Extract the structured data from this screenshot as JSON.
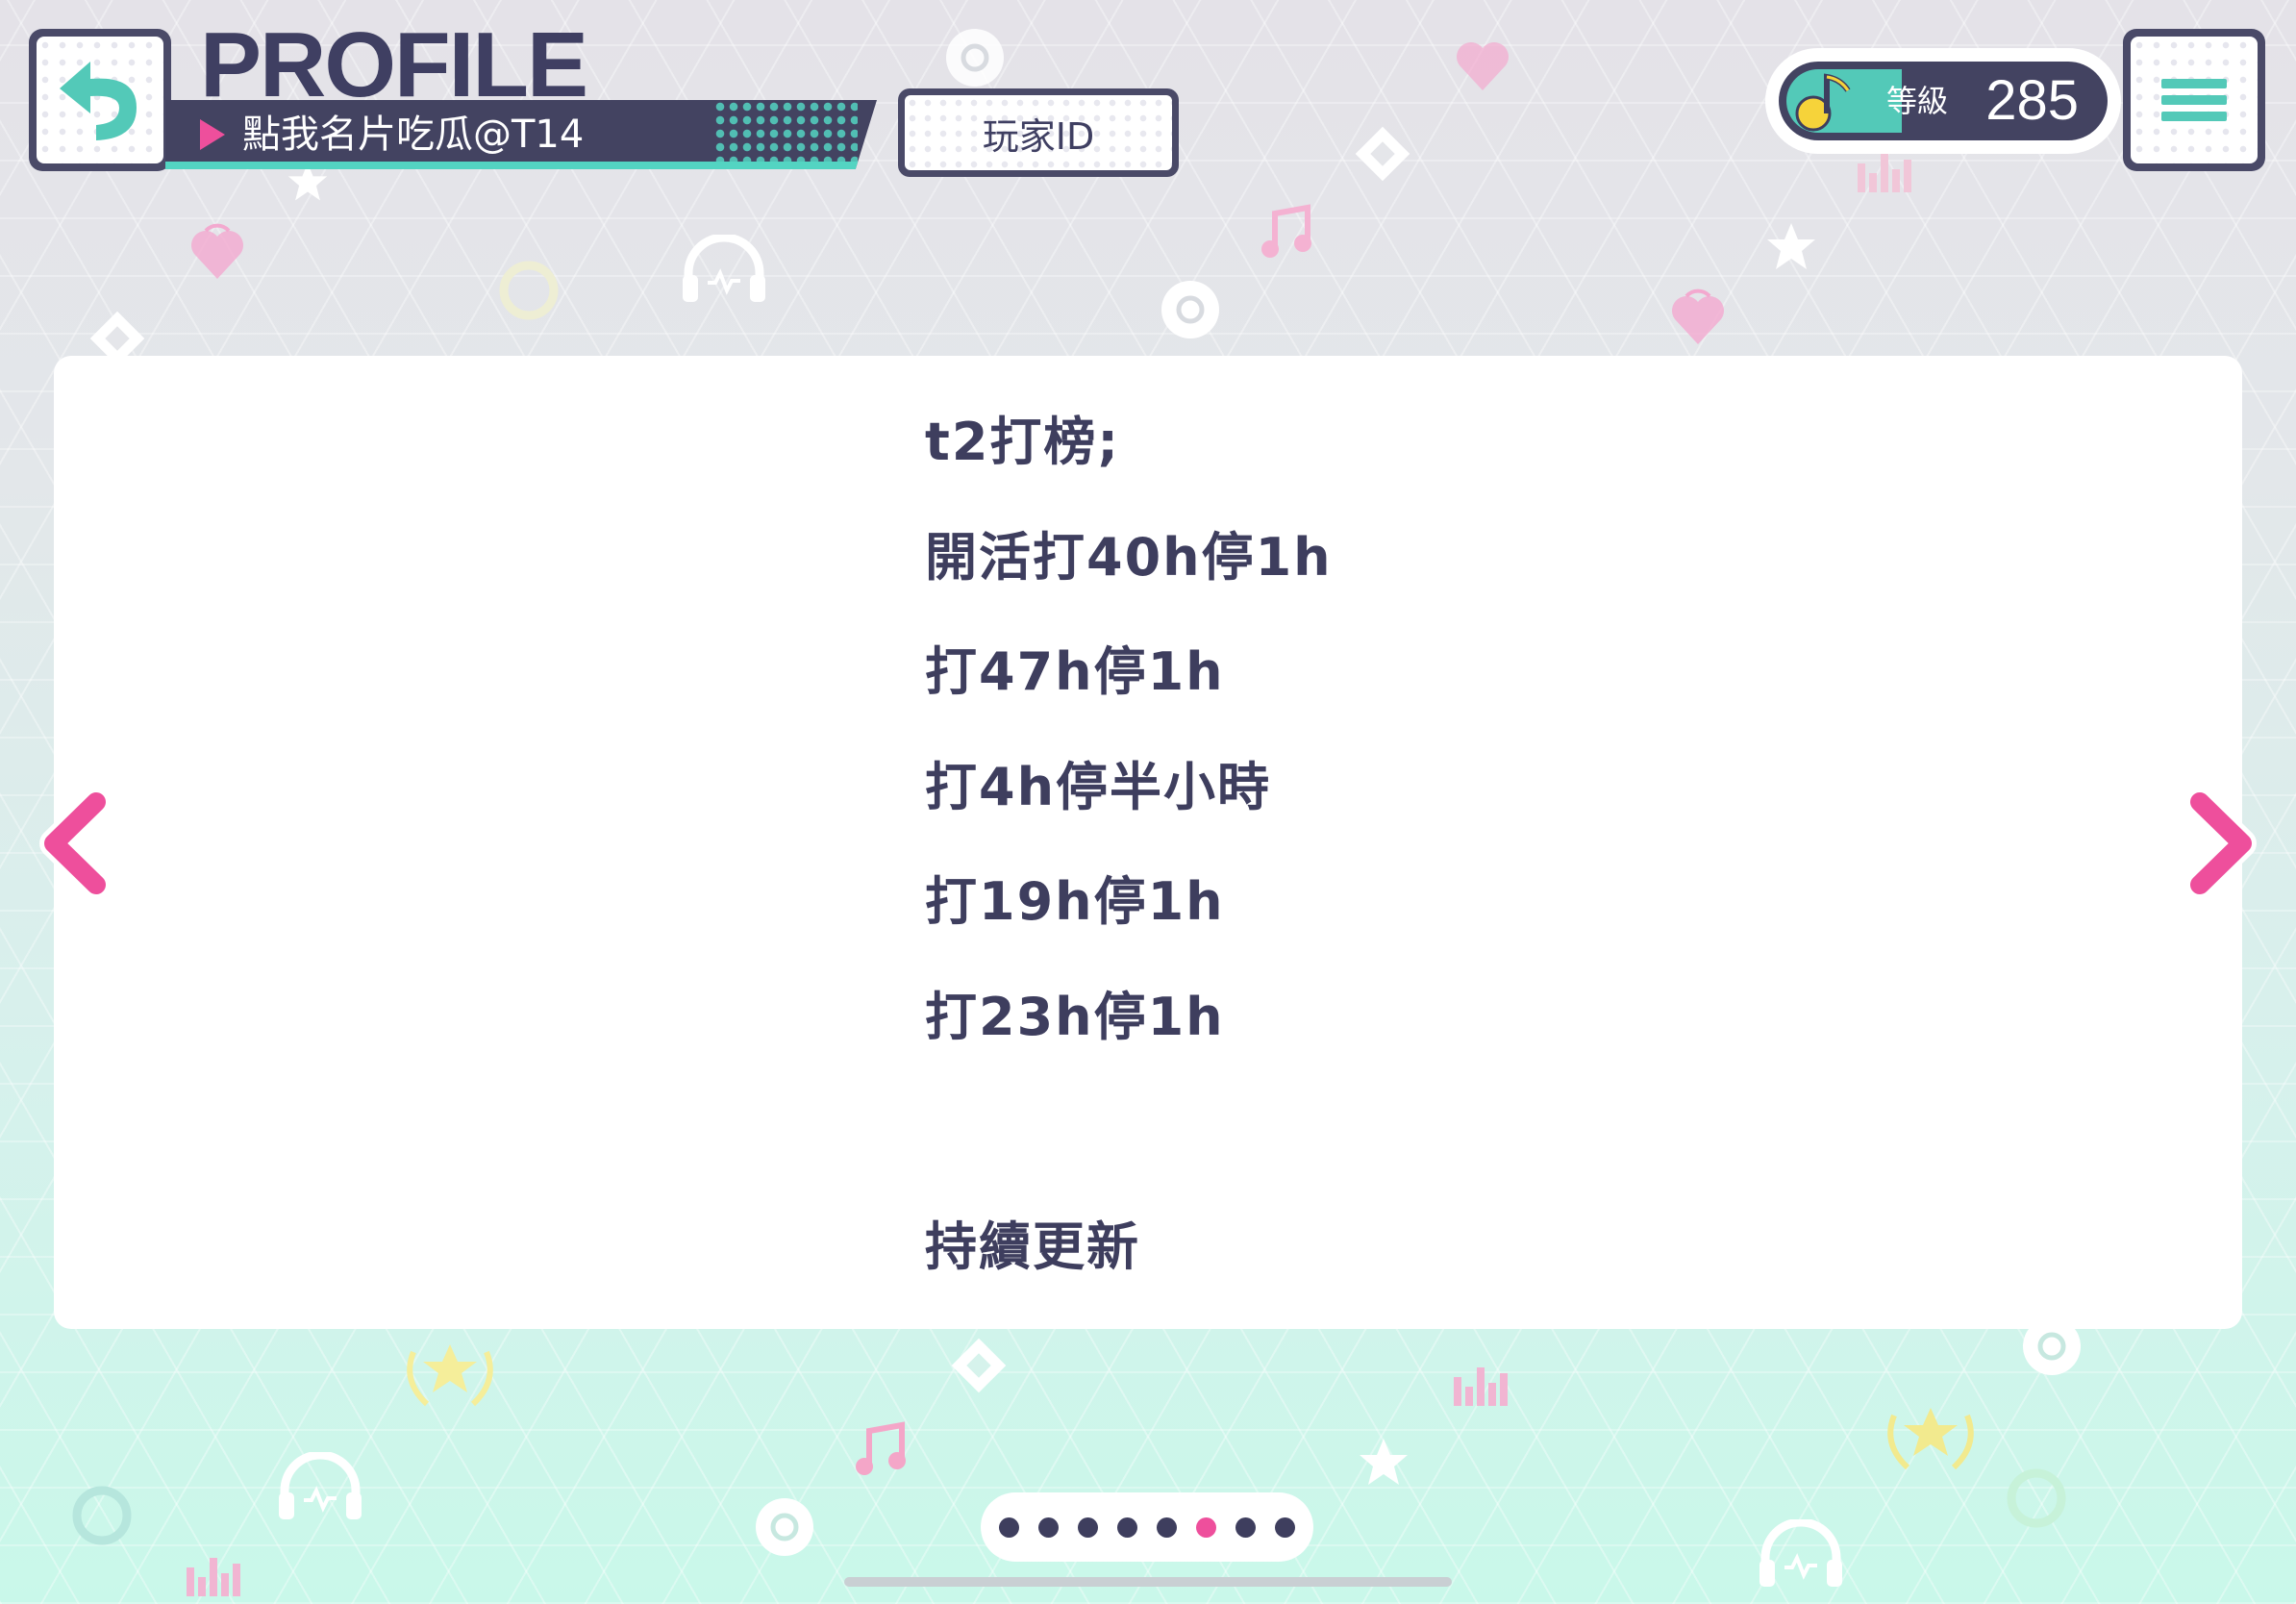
{
  "header": {
    "title": "PROFILE",
    "player_name": "點我名片吃瓜@T14",
    "player_id_label": "玩家ID",
    "level_label": "等級",
    "level_value": "285"
  },
  "bio": {
    "lines": [
      "t2打榜;",
      "開活打40h停1h",
      "打47h停1h",
      "打4h停半小時",
      "打19h停1h",
      "打23h停1h",
      "",
      "持續更新"
    ]
  },
  "pagination": {
    "total": 8,
    "current": 6
  },
  "icons": {
    "back": "back-arrow-icon",
    "menu": "hamburger-menu-icon",
    "level": "music-note-icon",
    "prev": "chevron-left-icon",
    "next": "chevron-right-icon"
  },
  "colors": {
    "navy": "#434361",
    "teal": "#53c9b8",
    "pink": "#ee4f9c",
    "text": "#3e3e5e"
  }
}
